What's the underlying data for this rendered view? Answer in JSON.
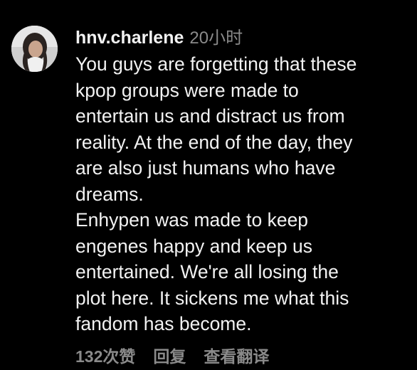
{
  "comment": {
    "username": "hnv.charlene",
    "timestamp": "20小时",
    "text_lines": [
      "You guys are forgetting that these",
      "kpop groups were made to",
      "entertain us and distract us from",
      "reality. At the end of the day, they",
      "are also just humans who have",
      "dreams.",
      "Enhypen was made to keep",
      "engenes happy and keep us",
      "entertained. We're all losing the",
      "plot here. It sickens me what this",
      "fandom has become."
    ],
    "likes_label": "132次赞",
    "reply_label": "回复",
    "translate_label": "查看翻译"
  },
  "colors": {
    "background": "#000000",
    "primary_text": "#f2f2f2",
    "secondary_text": "#8a8a8a"
  }
}
